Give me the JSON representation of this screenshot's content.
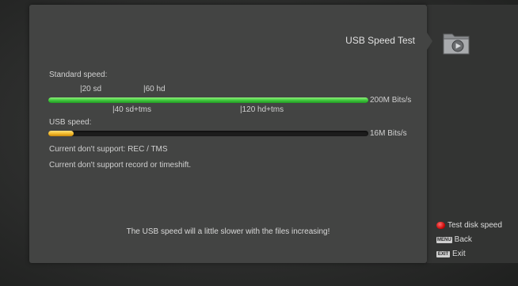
{
  "header": {
    "title": "USB Speed Test"
  },
  "standard": {
    "label": "Standard speed:",
    "ticks_top": [
      "|20 sd",
      "|60 hd"
    ],
    "ticks_bottom": [
      "|40 sd+tms",
      "|120 hd+tms"
    ],
    "max_label": "200M Bits/s",
    "progress": 1.0
  },
  "usb": {
    "label": "USB speed:",
    "value_label": "16M Bits/s",
    "progress": 0.08
  },
  "messages": {
    "line1": "Current don't support: REC / TMS",
    "line2": "Current don't support record or timeshift."
  },
  "footer": {
    "note": "The USB speed will a little slower with the files increasing!"
  },
  "hints": {
    "test": {
      "label": "Test disk speed",
      "key": "red"
    },
    "back": {
      "label": "Back",
      "key": "MENU"
    },
    "exit": {
      "label": "Exit",
      "key": "EXIT"
    }
  },
  "icons": {
    "folder": "media-folder-icon"
  }
}
